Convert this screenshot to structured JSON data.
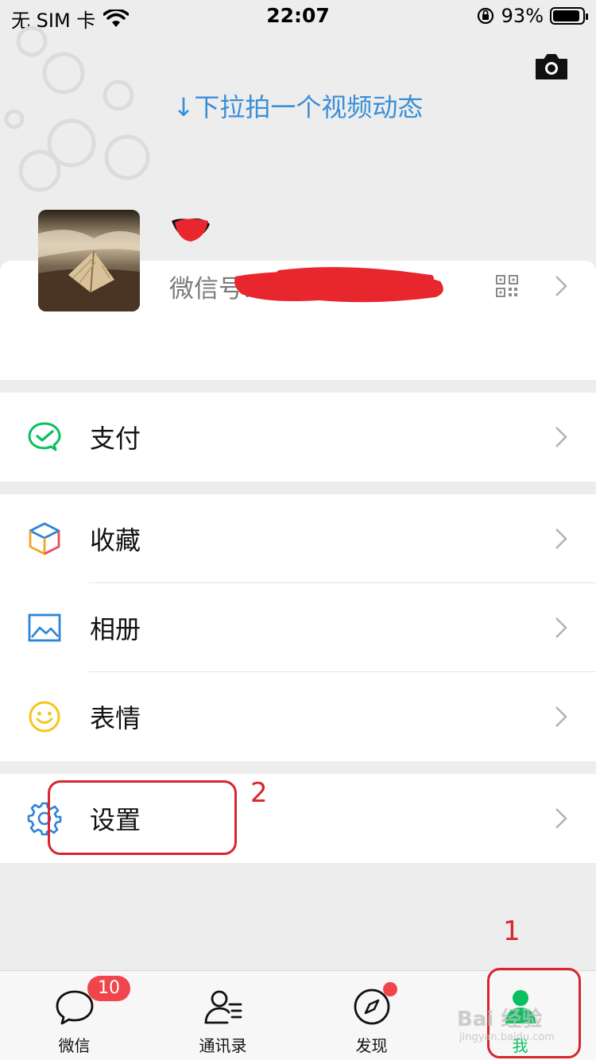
{
  "status_bar": {
    "carrier": "无 SIM 卡",
    "time": "22:07",
    "battery": "93%",
    "battery_level": 0.93
  },
  "header": {
    "pull_hint": "↓下拉拍一个视频动态",
    "camera_icon": "camera-icon"
  },
  "profile": {
    "nickname": "",
    "wechat_id_label": "微信号:",
    "qr_icon": "qr-code-icon"
  },
  "menu": {
    "pay": {
      "label": "支付",
      "icon": "wechat-pay-icon",
      "color": "#07c160"
    },
    "favorites": {
      "label": "收藏",
      "icon": "cube-icon"
    },
    "album": {
      "label": "相册",
      "icon": "picture-icon",
      "color": "#2b84d6"
    },
    "stickers": {
      "label": "表情",
      "icon": "smiley-icon",
      "color": "#f5c518"
    },
    "settings": {
      "label": "设置",
      "icon": "gear-icon",
      "color": "#2b84d6"
    }
  },
  "annotations": {
    "step1": "1",
    "step2": "2",
    "color": "#d7262e"
  },
  "tabs": {
    "chats": {
      "label": "微信",
      "badge": "10",
      "icon": "chat-bubble-icon"
    },
    "contacts": {
      "label": "通讯录",
      "icon": "contacts-icon"
    },
    "discover": {
      "label": "发现",
      "icon": "compass-icon"
    },
    "me": {
      "label": "我",
      "icon": "person-icon",
      "active": true
    }
  },
  "watermark": {
    "text": "Bai 经验",
    "sub": "jingyan.baidu.com"
  },
  "colors": {
    "accent": "#07c160",
    "link": "#3a8fd8",
    "badge": "#f0454b",
    "background": "#ededed"
  }
}
